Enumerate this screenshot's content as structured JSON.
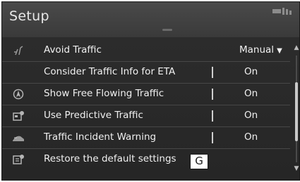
{
  "screen": {
    "title": "Setup"
  },
  "rows": [
    {
      "label": "Avoid Traffic",
      "value": "Manual",
      "icon": "avoid-traffic-icon",
      "type": "dropdown"
    },
    {
      "label": "Consider Traffic Info for ETA",
      "value": "On",
      "icon": "",
      "type": "toggle"
    },
    {
      "label": "Show Free Flowing Traffic",
      "value": "On",
      "icon": "free-flowing-traffic-icon",
      "type": "toggle"
    },
    {
      "label": "Use Predictive Traffic",
      "value": "On",
      "icon": "predictive-traffic-icon",
      "type": "toggle"
    },
    {
      "label": "Traffic Incident Warning",
      "value": "On",
      "icon": "incident-warning-icon",
      "type": "toggle"
    },
    {
      "label": "Restore the default settings",
      "value": "",
      "icon": "restore-defaults-icon",
      "type": "action"
    }
  ],
  "callout": {
    "letter": "G"
  },
  "colors": {
    "background": "#262626",
    "header": "#3a3a3a",
    "text": "#f0f0f0",
    "divider": "#474747"
  }
}
